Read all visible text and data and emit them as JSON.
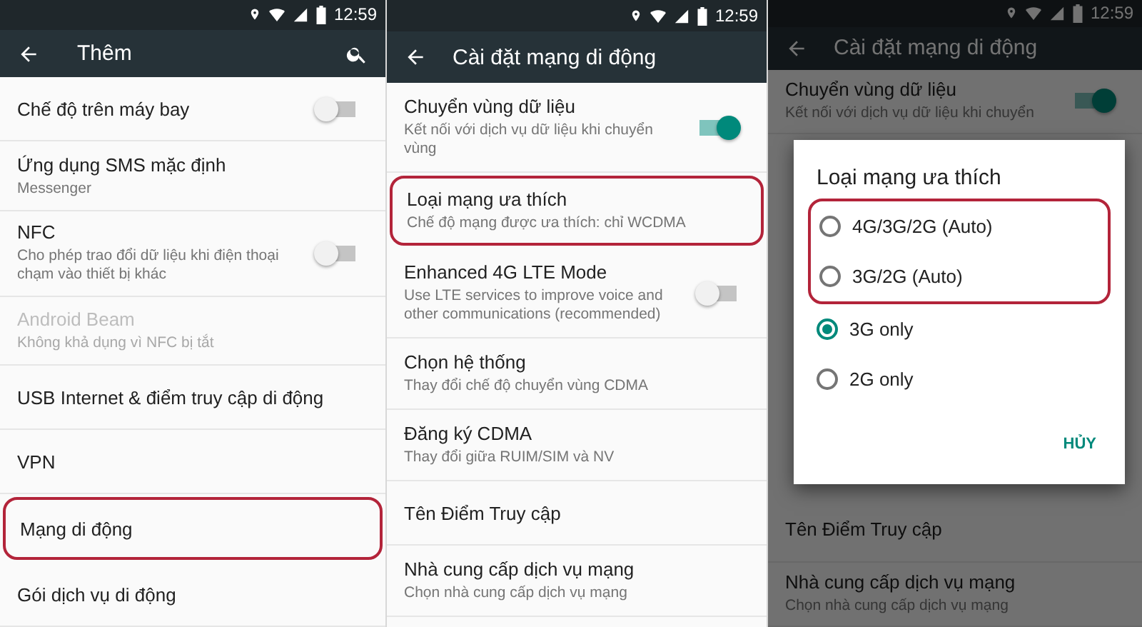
{
  "panels": [
    {
      "status_bar": {
        "time": "12:59"
      },
      "toolbar": {
        "title": "Thêm",
        "search": true
      },
      "dimmed": false,
      "items": [
        {
          "kind": "toggle",
          "title": "Chế độ trên máy bay",
          "on": false,
          "disabled": false,
          "highlighted": false
        },
        {
          "kind": "text",
          "title": "Ứng dụng SMS mặc định",
          "subtitle": "Messenger",
          "disabled": false,
          "highlighted": false
        },
        {
          "kind": "toggle",
          "title": "NFC",
          "subtitle": "Cho phép trao đổi dữ liệu khi điện thoại chạm vào thiết bị khác",
          "on": false,
          "disabled": false,
          "highlighted": false
        },
        {
          "kind": "text",
          "title": "Android Beam",
          "subtitle": "Không khả dụng vì NFC bị tắt",
          "disabled": true,
          "highlighted": false
        },
        {
          "kind": "text",
          "title": "USB Internet & điểm truy cập di động",
          "disabled": false,
          "highlighted": false
        },
        {
          "kind": "text",
          "title": "VPN",
          "disabled": false,
          "highlighted": false
        },
        {
          "kind": "text",
          "title": "Mạng di động",
          "disabled": false,
          "highlighted": true
        },
        {
          "kind": "text",
          "title": "Gói dịch vụ di động",
          "disabled": false,
          "highlighted": false
        }
      ]
    },
    {
      "status_bar": {
        "time": "12:59"
      },
      "toolbar": {
        "title": "Cài đặt mạng di động",
        "search": false
      },
      "dimmed": false,
      "items": [
        {
          "kind": "toggle",
          "title": "Chuyển vùng dữ liệu",
          "subtitle": "Kết nối với dịch vụ dữ liệu khi chuyển vùng",
          "on": true,
          "disabled": false,
          "highlighted": false
        },
        {
          "kind": "text",
          "title": "Loại mạng ưa thích",
          "subtitle": "Chế độ mạng được ưa thích: chỉ WCDMA",
          "disabled": false,
          "highlighted": true
        },
        {
          "kind": "toggle",
          "title": "Enhanced 4G LTE Mode",
          "subtitle": "Use LTE services to improve voice and other communications (recommended)",
          "on": false,
          "disabled": false,
          "highlighted": false
        },
        {
          "kind": "text",
          "title": "Chọn hệ thống",
          "subtitle": "Thay đổi chế độ chuyển vùng CDMA",
          "disabled": false,
          "highlighted": false
        },
        {
          "kind": "text",
          "title": "Đăng ký CDMA",
          "subtitle": "Thay đổi giữa RUIM/SIM và NV",
          "disabled": false,
          "highlighted": false
        },
        {
          "kind": "text",
          "title": "Tên Điểm Truy cập",
          "disabled": false,
          "highlighted": false
        },
        {
          "kind": "text",
          "title": "Nhà cung cấp dịch vụ mạng",
          "subtitle": "Chọn nhà cung cấp dịch vụ mạng",
          "disabled": false,
          "highlighted": false
        }
      ]
    },
    {
      "status_bar": {
        "time": "12:59"
      },
      "toolbar": {
        "title": "Cài đặt mạng di động",
        "search": false
      },
      "dimmed": true,
      "items": [
        {
          "kind": "toggle",
          "title": "Chuyển vùng dữ liệu",
          "subtitle": "Kết nối với dịch vụ dữ liệu khi chuyển",
          "on": true,
          "disabled": false,
          "highlighted": false
        },
        {
          "kind": "dialog",
          "title": "Loại mạng ưa thích",
          "options": [
            {
              "label": "4G/3G/2G (Auto)",
              "selected": false,
              "highlighted": true
            },
            {
              "label": "3G/2G (Auto)",
              "selected": false,
              "highlighted": true
            },
            {
              "label": "3G only",
              "selected": true,
              "highlighted": false
            },
            {
              "label": "2G only",
              "selected": false,
              "highlighted": false
            }
          ],
          "button": "HỦY"
        },
        {
          "kind": "text",
          "title": "Tên Điểm Truy cập",
          "disabled": false,
          "highlighted": false
        },
        {
          "kind": "text",
          "title": "Nhà cung cấp dịch vụ mạng",
          "subtitle": "Chọn nhà cung cấp dịch vụ mạng",
          "disabled": false,
          "highlighted": false
        }
      ]
    }
  ]
}
